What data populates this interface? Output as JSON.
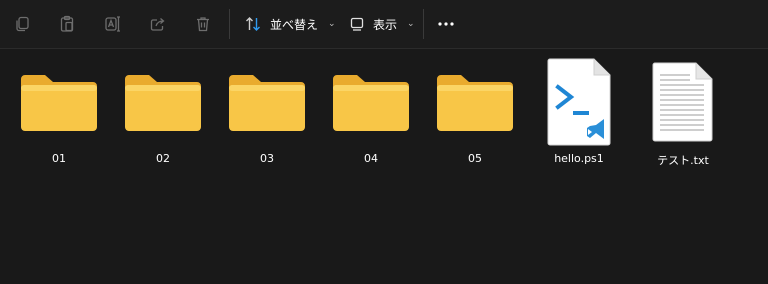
{
  "toolbar": {
    "copy_icon": "copy-icon",
    "paste_icon": "paste-icon",
    "rename_icon": "rename-icon",
    "share_icon": "share-icon",
    "delete_icon": "trash-icon",
    "sort_label": "並べ替え",
    "view_label": "表示",
    "more_icon": "more-icon"
  },
  "files": [
    {
      "name": "01",
      "type": "folder"
    },
    {
      "name": "02",
      "type": "folder"
    },
    {
      "name": "03",
      "type": "folder"
    },
    {
      "name": "04",
      "type": "folder"
    },
    {
      "name": "05",
      "type": "folder"
    },
    {
      "name": "hello.ps1",
      "type": "powershell-script"
    },
    {
      "name": "テスト.txt",
      "type": "text-file"
    }
  ],
  "colors": {
    "background": "#191919",
    "folder": "#f8c647",
    "accent": "#1f86d4"
  }
}
